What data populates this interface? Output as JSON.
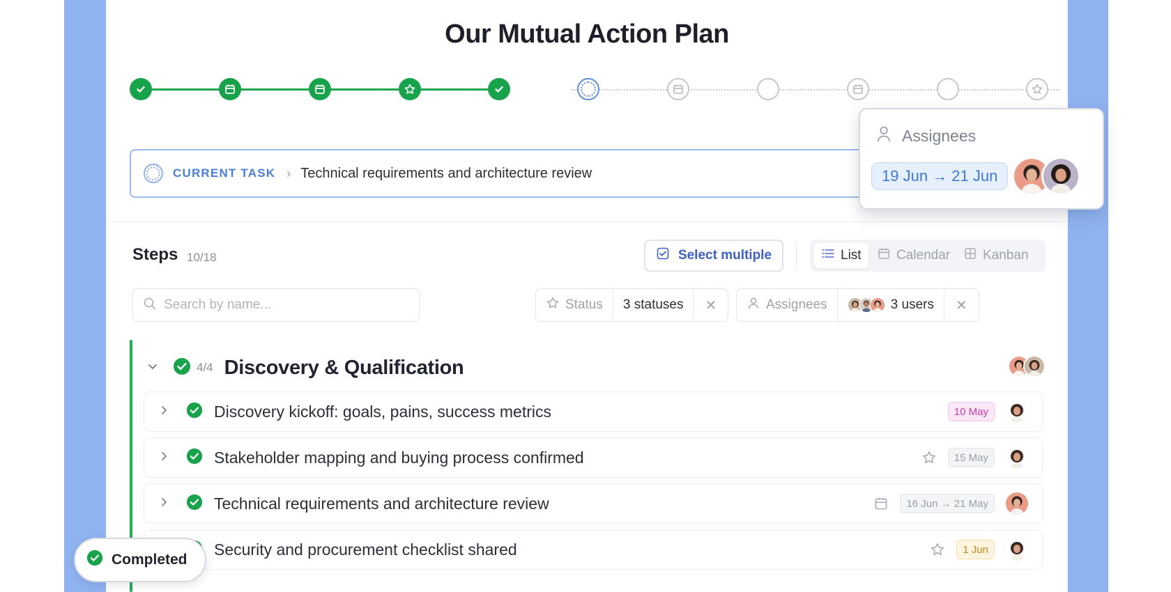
{
  "title": "Our Mutual Action Plan",
  "stepper": {
    "steps": [
      {
        "state": "done",
        "icon": "check-icon"
      },
      {
        "state": "done",
        "icon": "calendar-icon"
      },
      {
        "state": "done",
        "icon": "calendar-icon"
      },
      {
        "state": "done",
        "icon": "star-icon"
      },
      {
        "state": "done",
        "icon": "check-icon"
      },
      {
        "state": "current",
        "icon": "dotted-circle-icon"
      },
      {
        "state": "todo",
        "icon": "calendar-icon"
      },
      {
        "state": "todo",
        "icon": "circle-icon"
      },
      {
        "state": "todo",
        "icon": "calendar-icon"
      },
      {
        "state": "todo",
        "icon": "circle-icon"
      },
      {
        "state": "todo",
        "icon": "star-icon"
      }
    ]
  },
  "current_task": {
    "label": "CURRENT TASK",
    "text": "Technical requirements and architecture review"
  },
  "assignees_popover": {
    "label": "Assignees",
    "date_range": "19 Jun → 21 Jun"
  },
  "steps": {
    "title": "Steps",
    "count": "10/18",
    "select_multiple": "Select multiple",
    "views": [
      "List",
      "Calendar",
      "Kanban"
    ],
    "active_view": "List"
  },
  "search": {
    "placeholder": "Search by name..."
  },
  "filters": {
    "status": {
      "label": "Status",
      "value": "3 statuses"
    },
    "assignees": {
      "label": "Assignees",
      "value": "3 users"
    }
  },
  "section": {
    "count": "4/4",
    "title": "Discovery & Qualification",
    "tasks": [
      {
        "text": "Discovery kickoff: goals, pains, success metrics",
        "date": "10 May",
        "tag_style": "pink"
      },
      {
        "text": "Stakeholder mapping and buying process confirmed",
        "date": "15 May",
        "tag_style": "gray"
      },
      {
        "text": "Technical requirements and architecture review",
        "date": "16 Jun → 21 May",
        "tag_style": "gray"
      },
      {
        "text": "Security and procurement checklist shared",
        "date": "1 Jun",
        "tag_style": "amber"
      }
    ]
  },
  "completed_badge": "Completed",
  "colors": {
    "accent_green": "#16a34a",
    "accent_blue": "#4a7fe0",
    "background_blue": "#8fb3f0"
  }
}
